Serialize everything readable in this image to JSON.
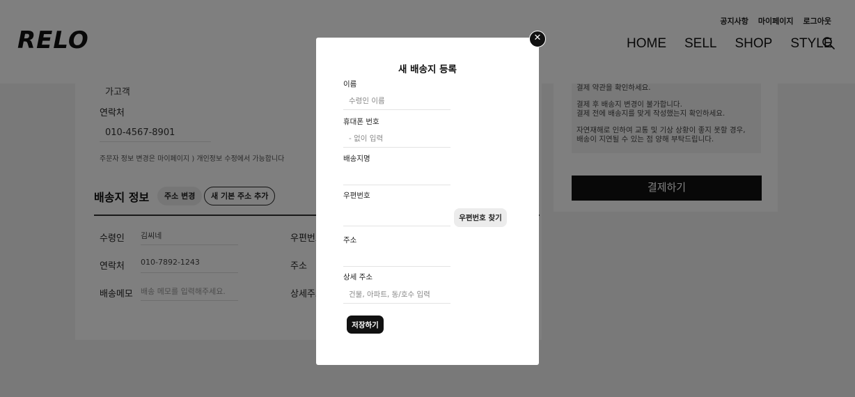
{
  "header": {
    "logo": "RELO",
    "util_links": [
      "공지사항",
      "마이페이지",
      "로그아웃"
    ],
    "nav": [
      "HOME",
      "SELL",
      "SHOP",
      "STYLE"
    ],
    "search_icon": "search-icon"
  },
  "orderer": {
    "name_value": "가고객",
    "phone_label": "연락처",
    "phone_value": "010-4567-8901",
    "note": "주문자 정보 변경은 마이페이지 ) 개인정보 수정에서 가능합니다"
  },
  "shipping": {
    "title": "배송지 정보",
    "change_button": "주소 변경",
    "add_button": "새 기본 주소 추가",
    "recipient_label": "수령인",
    "recipient_value": "김씨네",
    "phone_label": "연락처",
    "phone_value": "010-7892-1243",
    "memo_label": "배송메모",
    "memo_placeholder": "배송 메모를 입력해주세요.",
    "zip_label": "우편번호",
    "address_label": "주소",
    "detail_label": "상세주소"
  },
  "payment": {
    "notes": [
      "결제 약관을 확인하세요.",
      "",
      "결제 후 배송지 변경이 불가합니다.",
      "결제 전에 배송지를 맞게 작성했는지 확인하세요.",
      "",
      "자연재해로 인하여 교통 및 기상 상황이 좋지 못할 경우,",
      "배송이 지연될 수 있는 점 양해 부탁드립니다."
    ],
    "pay_button": "결제하기"
  },
  "modal": {
    "title": "새 배송지 등록",
    "close_symbol": "✕",
    "name_label": "이름",
    "name_placeholder": "수령인 이름",
    "phone_label": "휴대폰 번호",
    "phone_placeholder": "- 없이 입력",
    "alias_label": "배송지명",
    "zip_label": "우편번호",
    "zip_button": "우편번호 찾기",
    "address_label": "주소",
    "detail_label": "상세 주소",
    "detail_placeholder": "건물, 아파트, 동/호수 입력",
    "save_button": "저장하기"
  }
}
